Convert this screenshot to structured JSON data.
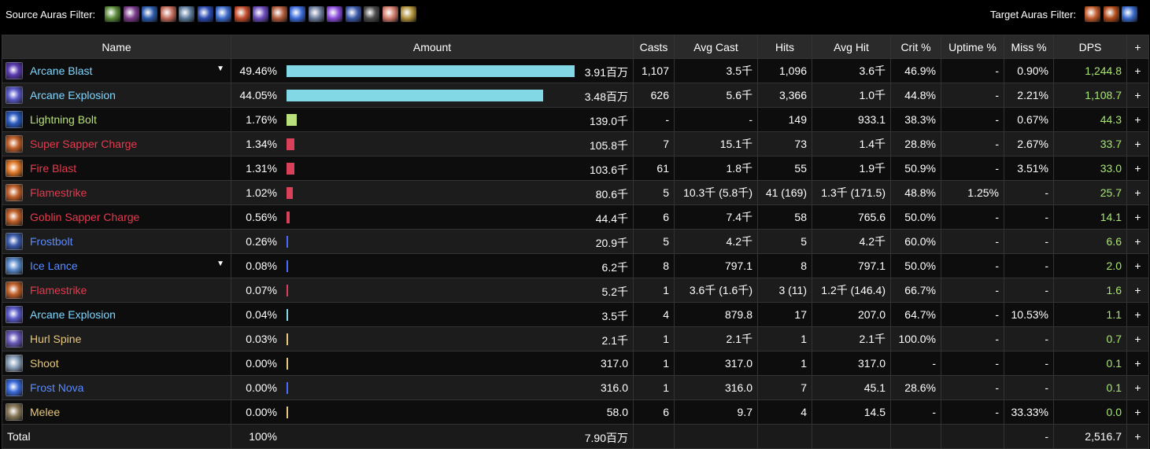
{
  "filters": {
    "source_label": "Source Auras Filter:",
    "target_label": "Target Auras Filter:",
    "source_icons": [
      {
        "name": "green-plant-aura-icon",
        "color": "#5a8a3a"
      },
      {
        "name": "shadow-spiral-aura-icon",
        "color": "#7a3a8a"
      },
      {
        "name": "blue-bolt-aura-icon",
        "color": "#2a5aaa"
      },
      {
        "name": "radiant-beams-aura-icon",
        "color": "#c06a5a"
      },
      {
        "name": "orb-aura-icon",
        "color": "#5a7a9a"
      },
      {
        "name": "blue-streak-aura-icon",
        "color": "#2a4ab0"
      },
      {
        "name": "frost-mage-aura-icon",
        "color": "#3a6aca"
      },
      {
        "name": "fire-slash-aura-icon",
        "color": "#c04a2a"
      },
      {
        "name": "purple-star-aura-icon",
        "color": "#6a4aba"
      },
      {
        "name": "fire-claw-aura-icon",
        "color": "#b05a3a"
      },
      {
        "name": "arcane-sphere-aura-icon",
        "color": "#3a6ada"
      },
      {
        "name": "wind-gust-aura-icon",
        "color": "#6a7a9a"
      },
      {
        "name": "violet-beam-aura-icon",
        "color": "#8a4ada"
      },
      {
        "name": "golden-sword-aura-icon",
        "color": "#3a5aaa"
      },
      {
        "name": "stone-armor-aura-icon",
        "color": "#4a4a4a"
      },
      {
        "name": "sunburst-aura-icon",
        "color": "#d07a6a"
      },
      {
        "name": "golden-bell-aura-icon",
        "color": "#b0903a"
      }
    ],
    "target_icons": [
      {
        "name": "fire-mask-aura-icon",
        "color": "#c05a2a"
      },
      {
        "name": "fire-mask-alt-aura-icon",
        "color": "#b04a1a"
      },
      {
        "name": "blue-streak-target-aura-icon",
        "color": "#3a6aca"
      }
    ]
  },
  "columns": [
    "Name",
    "Amount",
    "Casts",
    "Avg Cast",
    "Hits",
    "Avg Hit",
    "Crit %",
    "Uptime %",
    "Miss %",
    "DPS",
    "+"
  ],
  "rows": [
    {
      "name": "Arcane Blast",
      "name_color": "#7fd7ff",
      "icon": "arcane-blast-icon",
      "icon_color": "#5a3ab0",
      "caret": "▼",
      "pct": "49.46%",
      "bar": 0.4946,
      "bar_color": "#82d8e4",
      "amount": "3.91百万",
      "casts": "1,107",
      "avg_cast": "3.5千",
      "hits": "1,096",
      "avg_hit": "3.6千",
      "crit": "46.9%",
      "uptime": "-",
      "miss": "0.90%",
      "dps": "1,244.8",
      "plus": "+"
    },
    {
      "name": "Arcane Explosion",
      "name_color": "#7fd7ff",
      "icon": "arcane-explosion-icon",
      "icon_color": "#5a5aca",
      "caret": "",
      "pct": "44.05%",
      "bar": 0.4405,
      "bar_color": "#82d8e4",
      "amount": "3.48百万",
      "casts": "626",
      "avg_cast": "5.6千",
      "hits": "3,366",
      "avg_hit": "1.0千",
      "crit": "44.8%",
      "uptime": "-",
      "miss": "2.21%",
      "dps": "1,108.7",
      "plus": "+"
    },
    {
      "name": "Lightning Bolt",
      "name_color": "#b9e07a",
      "icon": "lightning-bolt-icon",
      "icon_color": "#2a5ac0",
      "caret": "",
      "pct": "1.76%",
      "bar": 0.0176,
      "bar_color": "#b9e07a",
      "amount": "139.0千",
      "casts": "-",
      "avg_cast": "-",
      "hits": "149",
      "avg_hit": "933.1",
      "crit": "38.3%",
      "uptime": "-",
      "miss": "0.67%",
      "dps": "44.3",
      "plus": "+"
    },
    {
      "name": "Super Sapper Charge",
      "name_color": "#e8394d",
      "icon": "sapper-charge-icon",
      "icon_color": "#c0602a",
      "caret": "",
      "pct": "1.34%",
      "bar": 0.0134,
      "bar_color": "#d9405a",
      "amount": "105.8千",
      "casts": "7",
      "avg_cast": "15.1千",
      "hits": "73",
      "avg_hit": "1.4千",
      "crit": "28.8%",
      "uptime": "-",
      "miss": "2.67%",
      "dps": "33.7",
      "plus": "+"
    },
    {
      "name": "Fire Blast",
      "name_color": "#e8394d",
      "icon": "fire-blast-icon",
      "icon_color": "#e07a2a",
      "caret": "",
      "pct": "1.31%",
      "bar": 0.0131,
      "bar_color": "#d9405a",
      "amount": "103.6千",
      "casts": "61",
      "avg_cast": "1.8千",
      "hits": "55",
      "avg_hit": "1.9千",
      "crit": "50.9%",
      "uptime": "-",
      "miss": "3.51%",
      "dps": "33.0",
      "plus": "+"
    },
    {
      "name": "Flamestrike",
      "name_color": "#e8394d",
      "icon": "flamestrike-icon",
      "icon_color": "#c0602a",
      "caret": "",
      "pct": "1.02%",
      "bar": 0.0102,
      "bar_color": "#d9405a",
      "amount": "80.6千",
      "casts": "5",
      "avg_cast": "10.3千 (5.8千)",
      "hits": "41 (169)",
      "avg_hit": "1.3千 (171.5)",
      "crit": "48.8%",
      "uptime": "1.25%",
      "miss": "-",
      "dps": "25.7",
      "plus": "+"
    },
    {
      "name": "Goblin Sapper Charge",
      "name_color": "#e8394d",
      "icon": "goblin-sapper-icon",
      "icon_color": "#c0602a",
      "caret": "",
      "pct": "0.56%",
      "bar": 0.0056,
      "bar_color": "#d9405a",
      "amount": "44.4千",
      "casts": "6",
      "avg_cast": "7.4千",
      "hits": "58",
      "avg_hit": "765.6",
      "crit": "50.0%",
      "uptime": "-",
      "miss": "-",
      "dps": "14.1",
      "plus": "+"
    },
    {
      "name": "Frostbolt",
      "name_color": "#5a8cff",
      "icon": "frostbolt-icon",
      "icon_color": "#3a5aaa",
      "caret": "",
      "pct": "0.26%",
      "bar": 0.0026,
      "bar_color": "#4a6aff",
      "amount": "20.9千",
      "casts": "5",
      "avg_cast": "4.2千",
      "hits": "5",
      "avg_hit": "4.2千",
      "crit": "60.0%",
      "uptime": "-",
      "miss": "-",
      "dps": "6.6",
      "plus": "+"
    },
    {
      "name": "Ice Lance",
      "name_color": "#5a8cff",
      "icon": "ice-lance-icon",
      "icon_color": "#5a8aca",
      "caret": "▼",
      "pct": "0.08%",
      "bar": 0.0008,
      "bar_color": "#4a6aff",
      "amount": "6.2千",
      "casts": "8",
      "avg_cast": "797.1",
      "hits": "8",
      "avg_hit": "797.1",
      "crit": "50.0%",
      "uptime": "-",
      "miss": "-",
      "dps": "2.0",
      "plus": "+"
    },
    {
      "name": "Flamestrike",
      "name_color": "#e8394d",
      "icon": "flamestrike-icon",
      "icon_color": "#c0602a",
      "caret": "",
      "pct": "0.07%",
      "bar": 0.0007,
      "bar_color": "#d9405a",
      "amount": "5.2千",
      "casts": "1",
      "avg_cast": "3.6千 (1.6千)",
      "hits": "3 (11)",
      "avg_hit": "1.2千 (146.4)",
      "crit": "66.7%",
      "uptime": "-",
      "miss": "-",
      "dps": "1.6",
      "plus": "+"
    },
    {
      "name": "Arcane Explosion",
      "name_color": "#7fd7ff",
      "icon": "arcane-explosion-icon",
      "icon_color": "#5a5aca",
      "caret": "",
      "pct": "0.04%",
      "bar": 0.0004,
      "bar_color": "#82d8e4",
      "amount": "3.5千",
      "casts": "4",
      "avg_cast": "879.8",
      "hits": "17",
      "avg_hit": "207.0",
      "crit": "64.7%",
      "uptime": "-",
      "miss": "10.53%",
      "dps": "1.1",
      "plus": "+"
    },
    {
      "name": "Hurl Spine",
      "name_color": "#e8c87a",
      "icon": "hurl-spine-icon",
      "icon_color": "#6a5aba",
      "caret": "",
      "pct": "0.03%",
      "bar": 0.0003,
      "bar_color": "#e8c87a",
      "amount": "2.1千",
      "casts": "1",
      "avg_cast": "2.1千",
      "hits": "1",
      "avg_hit": "2.1千",
      "crit": "100.0%",
      "uptime": "-",
      "miss": "-",
      "dps": "0.7",
      "plus": "+"
    },
    {
      "name": "Shoot",
      "name_color": "#e8c87a",
      "icon": "shoot-icon",
      "icon_color": "#8aa0ba",
      "caret": "",
      "pct": "0.00%",
      "bar": 0.0,
      "bar_color": "#e8c87a",
      "amount": "317.0",
      "casts": "1",
      "avg_cast": "317.0",
      "hits": "1",
      "avg_hit": "317.0",
      "crit": "-",
      "uptime": "-",
      "miss": "-",
      "dps": "0.1",
      "plus": "+"
    },
    {
      "name": "Frost Nova",
      "name_color": "#5a8cff",
      "icon": "frost-nova-icon",
      "icon_color": "#3a6ada",
      "caret": "",
      "pct": "0.00%",
      "bar": 0.0,
      "bar_color": "#4a6aff",
      "amount": "316.0",
      "casts": "1",
      "avg_cast": "316.0",
      "hits": "7",
      "avg_hit": "45.1",
      "crit": "28.6%",
      "uptime": "-",
      "miss": "-",
      "dps": "0.1",
      "plus": "+"
    },
    {
      "name": "Melee",
      "name_color": "#e8c87a",
      "icon": "melee-icon",
      "icon_color": "#8a7a5a",
      "caret": "",
      "pct": "0.00%",
      "bar": 0.0,
      "bar_color": "#e8c87a",
      "amount": "58.0",
      "casts": "6",
      "avg_cast": "9.7",
      "hits": "4",
      "avg_hit": "14.5",
      "crit": "-",
      "uptime": "-",
      "miss": "33.33%",
      "dps": "0.0",
      "plus": "+"
    }
  ],
  "total": {
    "label": "Total",
    "pct": "100%",
    "amount": "7.90百万",
    "miss": "-",
    "dps": "2,516.7",
    "plus": "+"
  }
}
